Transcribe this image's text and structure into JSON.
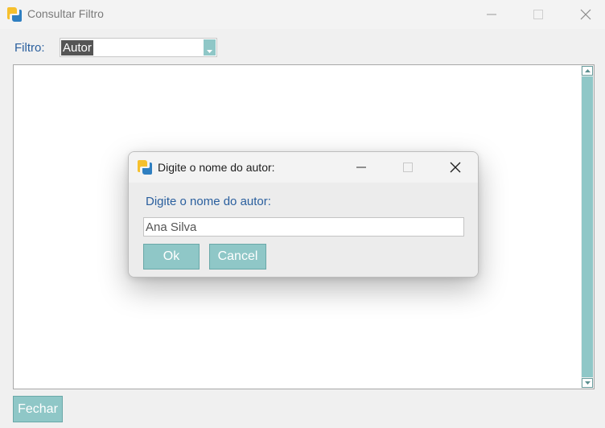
{
  "window": {
    "title": "Consultar Filtro",
    "icon": "python-logo-icon"
  },
  "filter": {
    "label": "Filtro:",
    "selected_value": "Autor"
  },
  "footer": {
    "close_label": "Fechar"
  },
  "dialog": {
    "title": "Digite o nome do autor:",
    "prompt": "Digite o nome do autor:",
    "input_value": "Ana Silva",
    "ok_label": "Ok",
    "cancel_label": "Cancel"
  },
  "colors": {
    "accent_teal": "#8fc7c7",
    "label_blue": "#2a5f9e",
    "background": "#f0f0f0"
  }
}
